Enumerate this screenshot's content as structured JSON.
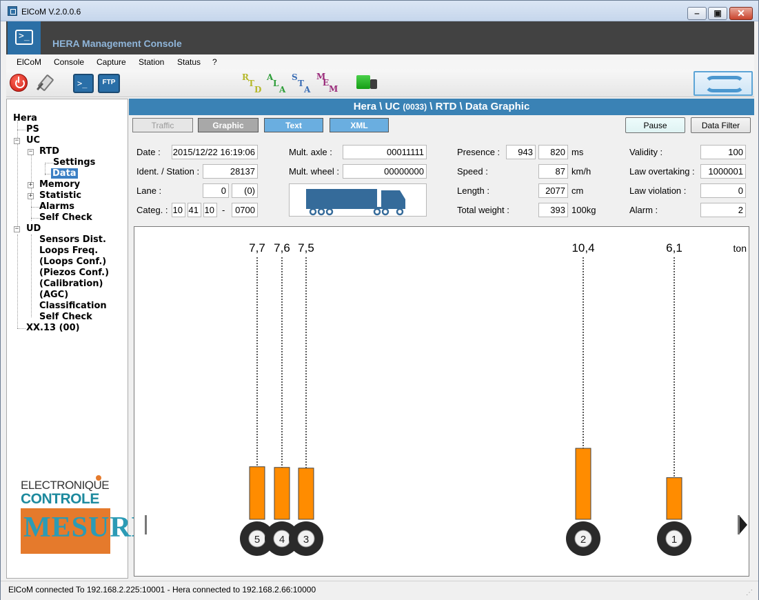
{
  "window": {
    "title": "ElCoM V.2.0.0.6"
  },
  "header": {
    "app_name": "HERA Management Console"
  },
  "menu": [
    "ElCoM",
    "Console",
    "Capture",
    "Station",
    "Status",
    "?"
  ],
  "toolbar": {
    "ftp_label": "FTP",
    "modes": [
      {
        "letters": [
          "R",
          "T",
          "D"
        ],
        "color": "#b5b82a"
      },
      {
        "letters": [
          "A",
          "L",
          "A"
        ],
        "color": "#2f9e3a"
      },
      {
        "letters": [
          "S",
          "T",
          "A"
        ],
        "color": "#3d6fb5"
      },
      {
        "letters": [
          "M",
          "E",
          "M"
        ],
        "color": "#9a2b7a"
      }
    ]
  },
  "tree": {
    "root": "Hera",
    "ps": "PS",
    "uc": "UC",
    "rtd": "RTD",
    "settings": "Settings",
    "data": "Data",
    "memory": "Memory",
    "statistic": "Statistic",
    "alarms": "Alarms",
    "uc_self_check": "Self Check",
    "ud": "UD",
    "ud_items": [
      "Sensors Dist.",
      "Loops Freq.",
      "(Loops Conf.)",
      "(Piezos Conf.)",
      "(Calibration)",
      "(AGC)",
      "Classification",
      "Self Check"
    ],
    "xx13": "XX.13 (00)"
  },
  "logo": {
    "line1": "ELECTRONIQUE",
    "line2": "CONTROLE",
    "line3": "MESURE"
  },
  "panel": {
    "title_pre": "Hera \\ UC ",
    "title_code": "(0033)",
    "title_post": " \\ RTD \\ Data Graphic"
  },
  "tabs": {
    "traffic": "Traffic",
    "graphic": "Graphic",
    "text": "Text",
    "xml": "XML"
  },
  "buttons": {
    "pause": "Pause",
    "data_filter": "Data Filter"
  },
  "fields": {
    "date_label": "Date :",
    "date": "2015/12/22 16:19:06",
    "ident_label": "Ident. / Station :",
    "ident": "28137",
    "lane_label": "Lane :",
    "lane": "0",
    "lane_paren": "(0)",
    "categ_label": "Categ. :",
    "categ": [
      "10",
      "41",
      "10"
    ],
    "categ_dash": "-",
    "categ_code": "0700",
    "mult_axle_label": "Mult. axle :",
    "mult_axle": "00011111",
    "mult_wheel_label": "Mult. wheel :",
    "mult_wheel": "00000000",
    "presence_label": "Presence :",
    "presence_1": "943",
    "presence_2": "820",
    "presence_unit": "ms",
    "speed_label": "Speed :",
    "speed": "87",
    "speed_unit": "km/h",
    "length_label": "Length :",
    "length": "2077",
    "length_unit": "cm",
    "weight_label": "Total weight :",
    "weight": "393",
    "weight_unit": "100kg",
    "validity_label": "Validity :",
    "validity": "100",
    "law_overtaking_label": "Law overtaking :",
    "law_overtaking": "1000001",
    "law_violation_label": "Law violation :",
    "law_violation": "0",
    "alarm_label": "Alarm :",
    "alarm": "2"
  },
  "chart_data": {
    "type": "bar",
    "unit": "ton",
    "categories": [
      "5",
      "4",
      "3",
      "2",
      "1"
    ],
    "values": [
      7.7,
      7.6,
      7.5,
      10.4,
      6.1
    ],
    "value_labels": [
      "7,7",
      "7,6",
      "7,5",
      "10,4",
      "6,1"
    ],
    "bar_color": "#ff8c00"
  },
  "status": {
    "text": "ElCoM connected To 192.168.2.225:10001  -  Hera connected to 192.168.2.66:10000"
  }
}
